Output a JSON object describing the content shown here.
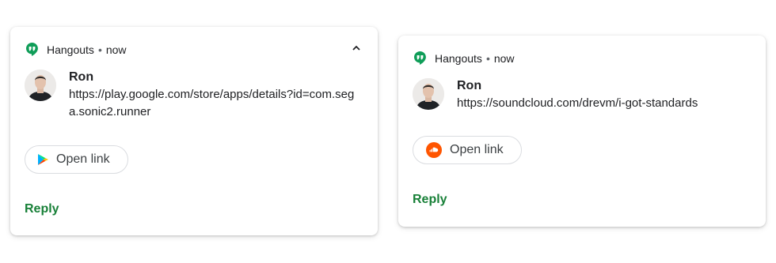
{
  "notifications": [
    {
      "app_name": "Hangouts",
      "separator": "•",
      "time": "now",
      "sender": "Ron",
      "message": "https://play.google.com/store/apps/details?id=com.sega.sonic2.runner",
      "action_label": "Open link",
      "action_icon": "google-play-icon",
      "reply_label": "Reply",
      "expanded": true
    },
    {
      "app_name": "Hangouts",
      "separator": "•",
      "time": "now",
      "sender": "Ron",
      "message": "https://soundcloud.com/drevm/i-got-standards",
      "action_label": "Open link",
      "action_icon": "soundcloud-icon",
      "reply_label": "Reply",
      "expanded": false
    }
  ],
  "colors": {
    "hangouts_green": "#0f9d58",
    "reply_green": "#188038",
    "soundcloud_orange": "#ff5500"
  }
}
